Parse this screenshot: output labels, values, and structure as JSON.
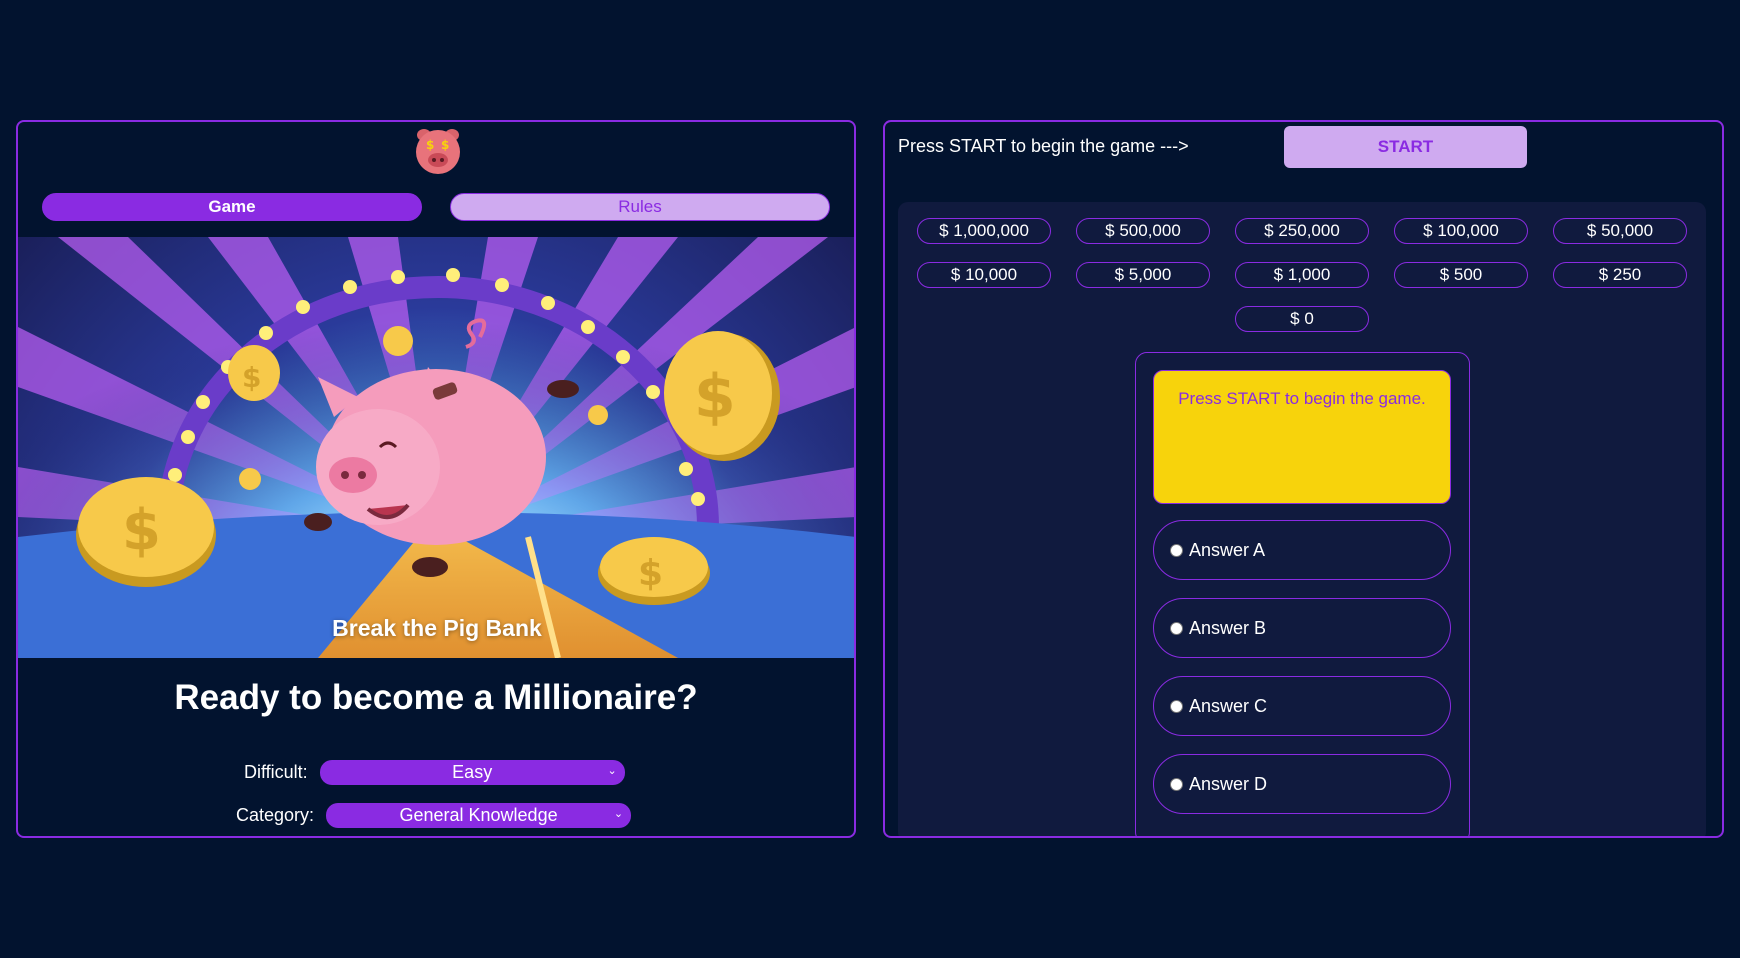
{
  "left": {
    "tabs": [
      {
        "label": "Game",
        "active": true
      },
      {
        "label": "Rules",
        "active": false
      }
    ],
    "hero_caption": "Break the Pig Bank",
    "headline": "Ready to become a Millionaire?",
    "difficulty": {
      "label": "Difficult:",
      "value": "Easy"
    },
    "category": {
      "label": "Category:",
      "value": "General Knowledge"
    }
  },
  "right": {
    "prompt": "Press START to begin the game --->",
    "start_label": "START",
    "prizes": [
      "$ 1,000,000",
      "$ 500,000",
      "$ 250,000",
      "$ 100,000",
      "$ 50,000",
      "$ 10,000",
      "$ 5,000",
      "$ 1,000",
      "$ 500",
      "$ 250",
      "$ 0"
    ],
    "question": "Press START to begin the game.",
    "answers": [
      "Answer A",
      "Answer B",
      "Answer C",
      "Answer D"
    ]
  },
  "colors": {
    "background": "#02132f",
    "accent": "#8a2be2",
    "accent_light": "#cfaaf0",
    "question_bg": "#f7d30c",
    "board_bg": "#101a3e"
  },
  "icons": {
    "logo": "pig-money-icon",
    "chevron": "chevron-down-icon",
    "radio": "radio-icon"
  }
}
